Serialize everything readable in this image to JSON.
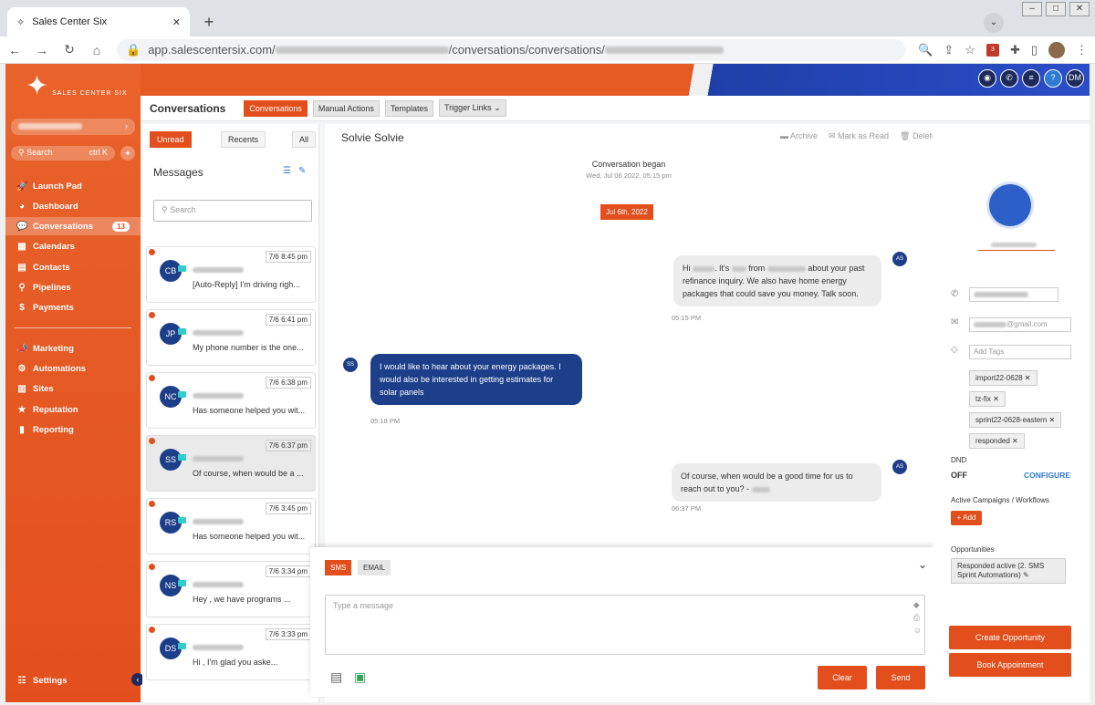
{
  "browser": {
    "tab_title": "Sales Center Six",
    "url_domain": "app.salescentersix.com/",
    "url_path": "/conversations/conversations/",
    "ext_badge": "3"
  },
  "sidebar": {
    "brand": "SALES CENTER SIX",
    "search": "Search",
    "shortcut": "ctrl K",
    "items": [
      {
        "label": "Launch Pad",
        "icon": "rocket-icon",
        "glyph": "🚀"
      },
      {
        "label": "Dashboard",
        "icon": "dashboard-icon",
        "glyph": "◕"
      },
      {
        "label": "Conversations",
        "icon": "chat-icon",
        "glyph": "💬",
        "badge": "13"
      },
      {
        "label": "Calendars",
        "icon": "calendar-icon",
        "glyph": "▦"
      },
      {
        "label": "Contacts",
        "icon": "contacts-icon",
        "glyph": "▤"
      },
      {
        "label": "Pipelines",
        "icon": "pipeline-icon",
        "glyph": "⚲"
      },
      {
        "label": "Payments",
        "icon": "payments-icon",
        "glyph": "$"
      },
      {
        "label": "Marketing",
        "icon": "marketing-icon",
        "glyph": "📣"
      },
      {
        "label": "Automations",
        "icon": "gear-icon",
        "glyph": "⚙"
      },
      {
        "label": "Sites",
        "icon": "sites-icon",
        "glyph": "▥"
      },
      {
        "label": "Reputation",
        "icon": "reputation-icon",
        "glyph": "★"
      },
      {
        "label": "Reporting",
        "icon": "reporting-icon",
        "glyph": "▮"
      }
    ],
    "settings": "Settings"
  },
  "header": {
    "title": "Conversations",
    "tabs": [
      "Conversations",
      "Manual Actions",
      "Templates",
      "Trigger Links ⌄"
    ],
    "avatar": "DM"
  },
  "list": {
    "filters": [
      "Unread",
      "Recents",
      "All"
    ],
    "heading": "Messages",
    "search_placeholder": "Search",
    "conversations": [
      {
        "initials": "CB",
        "time": "7/6 8:45 pm",
        "preview": "[Auto-Reply] I'm driving righ..."
      },
      {
        "initials": "JP",
        "time": "7/6 6:41 pm",
        "preview": "My phone number is the one..."
      },
      {
        "initials": "NC",
        "time": "7/6 6:38 pm",
        "preview": "Has someone helped you wit..."
      },
      {
        "initials": "SS",
        "time": "7/6 6:37 pm",
        "preview": "Of course, when would be a ..."
      },
      {
        "initials": "RS",
        "time": "7/6 3:45 pm",
        "preview": "Has someone helped you wit..."
      },
      {
        "initials": "NS",
        "time": "7/6 3:34 pm",
        "preview": "Hey , we have programs ..."
      },
      {
        "initials": "DS",
        "time": "7/6 3:33 pm",
        "preview": "Hi , I'm glad you aske..."
      }
    ]
  },
  "chat": {
    "contact": "Solvie Solvie",
    "actions": [
      "Archive",
      "Mark as Read",
      "Delete"
    ],
    "began": "Conversation began",
    "began_time": "Wed, Jul 06 2022, 05:15 pm",
    "date_pill": "Jul 6th, 2022",
    "messages": [
      {
        "dir": "out",
        "initials": "AS",
        "t1": "Hi",
        "t2": ". It's",
        "t3": "from",
        "t4": "about your past refinance inquiry. We also have home energy packages that could save you money. Talk soon.",
        "time": "05:15 PM"
      },
      {
        "dir": "in",
        "initials": "SS",
        "text": "I would like to hear about your energy packages. I would also be interested in getting estimates for solar panels",
        "time": "05:18 PM"
      },
      {
        "dir": "out",
        "initials": "AS",
        "text": "Of course, when would be a good time for us to reach out to you? -",
        "time": "06:37 PM"
      }
    ]
  },
  "composer": {
    "tabs": [
      "SMS",
      "EMAIL"
    ],
    "placeholder": "Type a message",
    "clear": "Clear",
    "send": "Send"
  },
  "right": {
    "tags_placeholder": "Add Tags",
    "tags": [
      "import22-0628",
      "tz-fix",
      "sprint22-0628-eastern",
      "responded"
    ],
    "dnd_label": "DND",
    "dnd_value": "OFF",
    "configure": "CONFIGURE",
    "campaigns_label": "Active Campaigns / Workflows",
    "add": "+ Add",
    "opps_label": "Opportunities",
    "opp": "Responded active (2. SMS Sprint Automations)",
    "create": "Create Opportunity",
    "book": "Book Appointment",
    "email_suffix": "@gmail.com"
  }
}
